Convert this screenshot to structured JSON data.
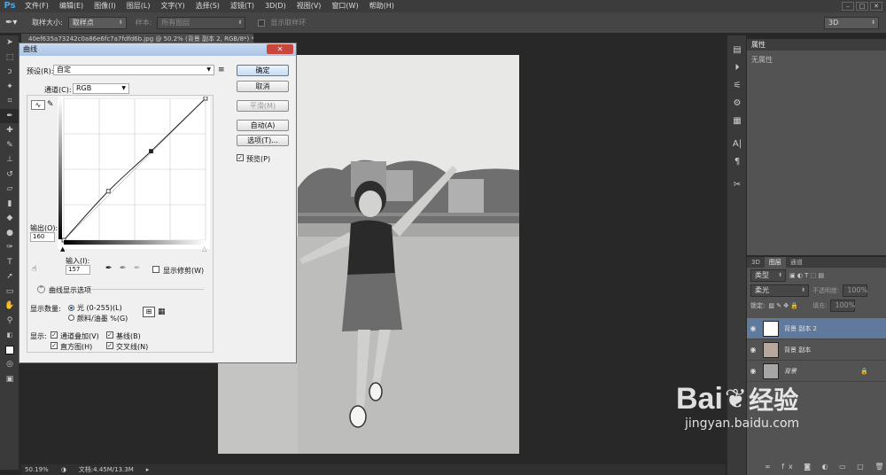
{
  "app": {
    "logo": "Ps"
  },
  "menu": [
    "文件(F)",
    "编辑(E)",
    "图像(I)",
    "图层(L)",
    "文字(Y)",
    "选择(S)",
    "滤镜(T)",
    "3D(D)",
    "视图(V)",
    "窗口(W)",
    "帮助(H)"
  ],
  "window_buttons": [
    "–",
    "□",
    "✕"
  ],
  "options_bar": {
    "sample_size_label": "取样大小:",
    "sample_size_value": "取样点",
    "sample_label": "样本:",
    "sample_value": "所有图层",
    "show_ring_label": "显示取样环",
    "workspace_value": "3D"
  },
  "document_tab": "40ef635a73242c0a86e6fc7a7fdfd6b.jpg @ 50.2% (背景 副本 2, RGB/8*) *",
  "status": {
    "zoom": "50.19%",
    "doc_size": "文档:4.45M/13.3M"
  },
  "properties": {
    "tab": "属性",
    "body": "无属性"
  },
  "layers_panel": {
    "tabs": [
      "3D",
      "图层",
      "通道"
    ],
    "filter_label": "类型",
    "blend_mode": "柔光",
    "opacity_label": "不透明度:",
    "opacity_value": "100%",
    "lock_label": "锁定:",
    "fill_label": "填充:",
    "fill_value": "100%",
    "layers": [
      {
        "name": "背景 副本 2",
        "selected": true
      },
      {
        "name": "背景 副本",
        "selected": false
      },
      {
        "name": "背景",
        "selected": false
      }
    ]
  },
  "curves": {
    "title": "曲线",
    "close": "✕",
    "preset_label": "预设(R):",
    "preset_value": "自定",
    "channel_label": "通道(C):",
    "channel_value": "RGB",
    "output_label": "输出(O):",
    "output_value": "160",
    "input_label": "输入(I):",
    "input_value": "157",
    "show_clipping": "显示修剪(W)",
    "curve_options": "曲线显示选项",
    "show_amount_label": "显示数量:",
    "light_option": "光 (0-255)(L)",
    "pigment_option": "颜料/油墨 %(G)",
    "show_label": "显示:",
    "channel_overlay": "通道叠加(V)",
    "baseline": "基线(B)",
    "histogram": "直方图(H)",
    "intersection": "交叉线(N)",
    "buttons": {
      "ok": "确定",
      "cancel": "取消",
      "smooth": "平滑(M)",
      "auto": "自动(A)",
      "options": "选项(T)..."
    },
    "preview": "预览(P)",
    "curve_points": [
      [
        0,
        0
      ],
      [
        80,
        88
      ],
      [
        157,
        160
      ],
      [
        255,
        255
      ]
    ]
  },
  "watermark": {
    "brand": "Bai",
    "brand2": "经验",
    "url": "jingyan.baidu.com"
  }
}
